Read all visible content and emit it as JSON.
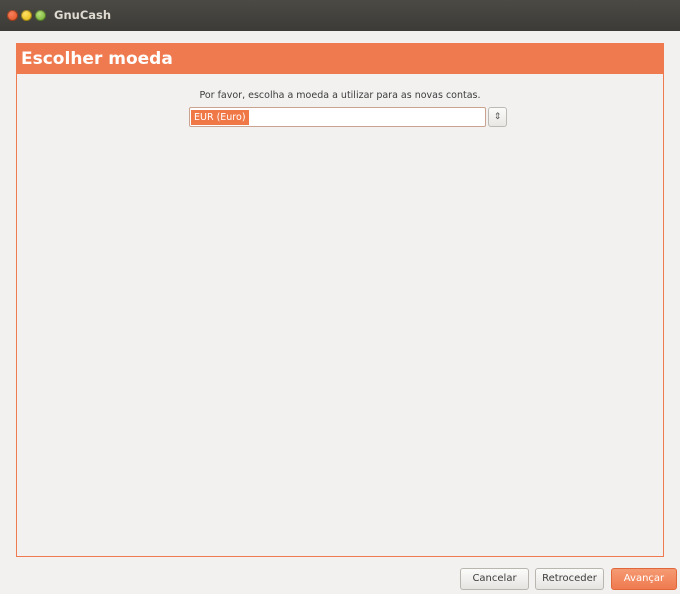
{
  "window": {
    "title": "GnuCash",
    "close_icon": "close-icon",
    "minimize_icon": "minimize-icon",
    "maximize_icon": "maximize-icon"
  },
  "page": {
    "header": "Escolher moeda",
    "prompt": "Por favor, escolha a moeda a utilizar para as novas contas.",
    "currency": {
      "selected": "EUR (Euro)",
      "spin_icon": "up-down-arrows-icon"
    }
  },
  "buttons": {
    "cancel": "Cancelar",
    "back": "Retroceder",
    "next": "Avançar"
  },
  "colors": {
    "accent": "#ef7a4f",
    "titlebar": "#3c3b37",
    "background": "#f2f1f0"
  }
}
